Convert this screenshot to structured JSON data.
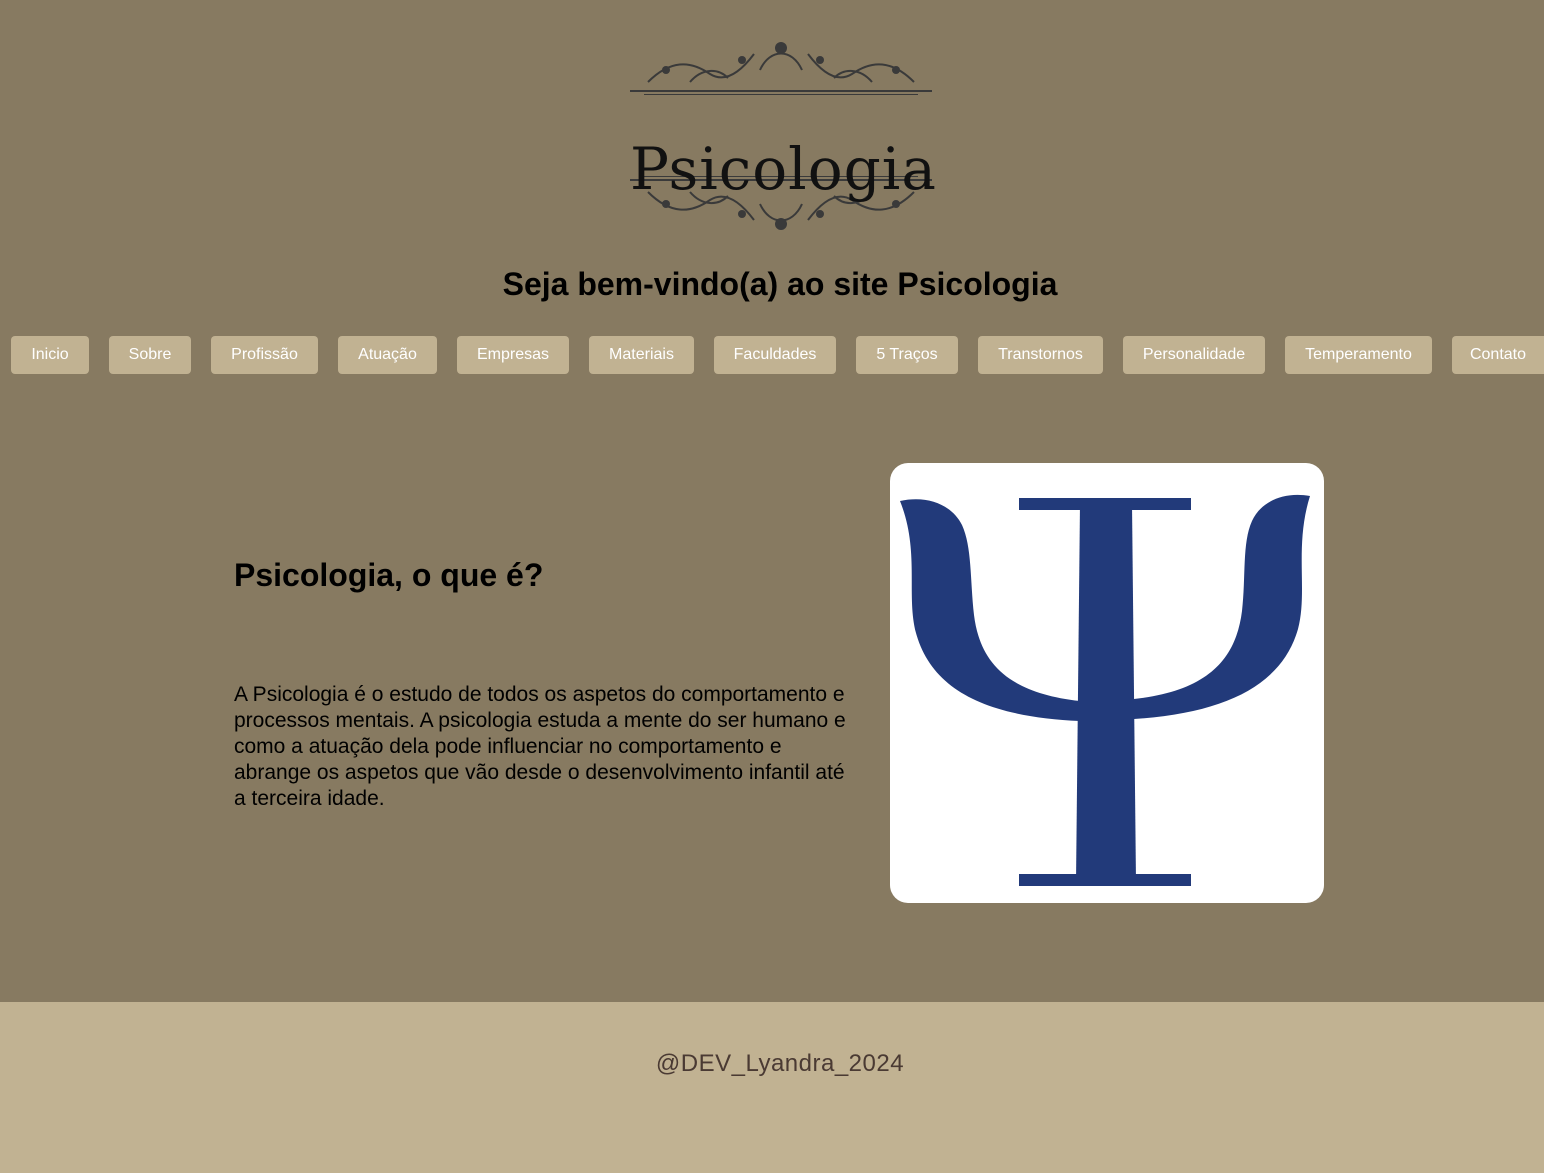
{
  "header": {
    "logo_text": "Psicologia",
    "welcome": "Seja bem-vindo(a) ao site Psicologia"
  },
  "nav": {
    "items": [
      "Inicio",
      "Sobre",
      "Profissão",
      "Atuação",
      "Empresas",
      "Materiais",
      "Faculdades",
      "5 Traços",
      "Transtornos",
      "Personalidade",
      "Temperamento",
      "Contato"
    ]
  },
  "main": {
    "heading": "Psicologia, o que é?",
    "description": "A Psicologia é o estudo de todos os aspetos do comportamento e processos mentais. A psicologia estuda a mente do ser humano e como a atuação dela pode influenciar no comportamento e abrange os aspetos que vão desde o desenvolvimento infantil até a terceira idade.",
    "image_icon": "psi-symbol-icon"
  },
  "footer": {
    "credit": "@DEV_Lyandra_2024"
  },
  "colors": {
    "background": "#877a61",
    "button": "#c1b292",
    "footer": "#c1b292",
    "psi": "#223a7a"
  }
}
